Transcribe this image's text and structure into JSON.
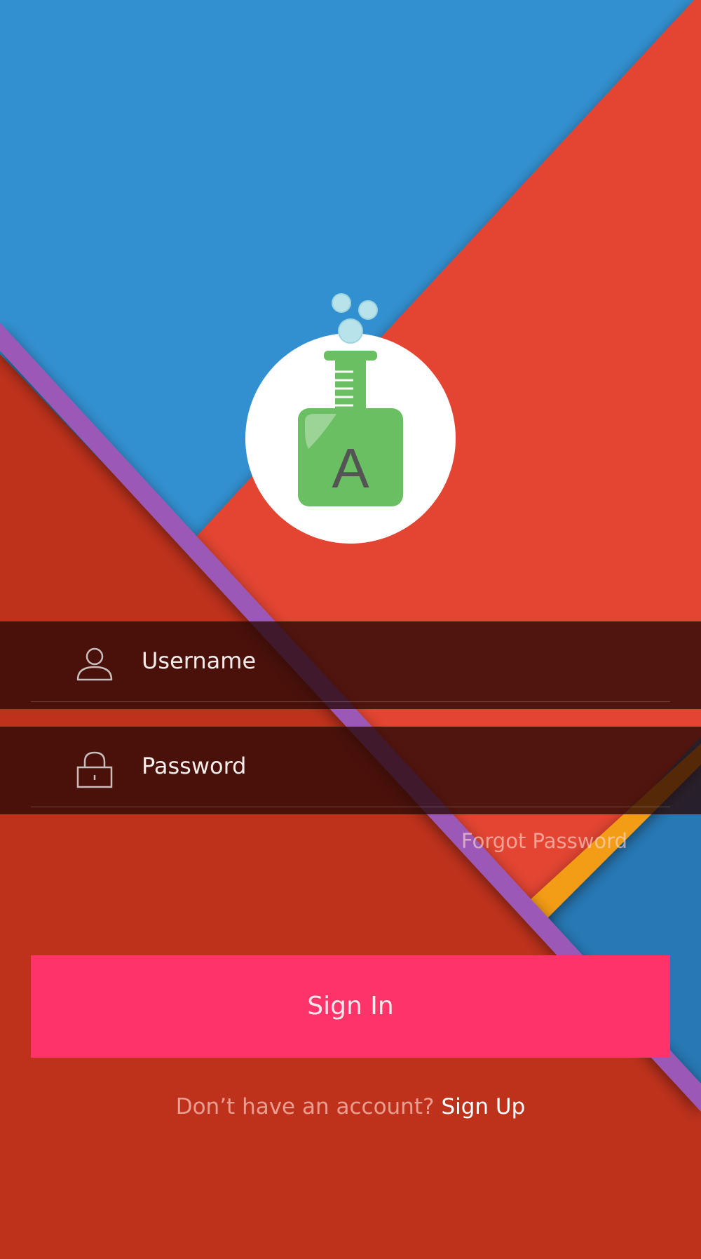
{
  "login": {
    "username_placeholder": "Username",
    "password_placeholder": "Password",
    "forgot_password": "Forgot Password",
    "sign_in": "Sign In",
    "signup_prompt": "Don’t have an account?",
    "signup_link": "Sign Up"
  },
  "logo": {
    "letter": "A",
    "icon": "flask-icon"
  },
  "icons": {
    "username": "user-icon",
    "password": "lock-icon"
  },
  "colors": {
    "blue": "#3390d0",
    "red_light": "#e34531",
    "red_dark": "#be301f",
    "purple": "#9b59b6",
    "orange": "#f39c12",
    "sign_in_button": "#fe3369",
    "flask_green": "#6bbf63"
  }
}
